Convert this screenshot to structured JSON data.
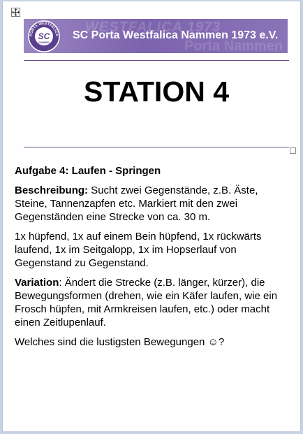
{
  "banner": {
    "logo_text_top": "PORTA WESTFALICA 1973",
    "logo_initials": "SC",
    "logo_text_small": "NAMMEN",
    "watermark": "WESTFALICA 1973",
    "watermark_bottom": "Porta Nammen",
    "title": "SC Porta Westfalica Nammen 1973 e.V."
  },
  "station_title": "STATION 4",
  "task": {
    "heading": "Aufgabe 4: Laufen - Springen",
    "description_label": "Beschreibung:",
    "description_text": " Sucht zwei Gegenstände, z.B. Äste, Steine, Tannenzapfen etc. Markiert mit den zwei Gegenständen eine Strecke von ca. 30 m.",
    "movements": "1x hüpfend, 1x auf einem Bein hüpfend, 1x rückwärts laufend, 1x im Seitgalopp, 1x im Hopserlauf von Gegenstand zu Gegenstand.",
    "variation_label": "Variation",
    "variation_text": ": Ändert die Strecke (z.B. länger, kürzer), die Bewegungsformen (drehen, wie ein Käfer laufen, wie ein Frosch hüpfen, mit Armkreisen laufen, etc.) oder macht einen Zeitlupenlauf.",
    "question": "Welches sind die lustigsten Bewegungen ☺?"
  },
  "colors": {
    "banner": "#7c63ad",
    "rule": "#6b4a8a"
  }
}
